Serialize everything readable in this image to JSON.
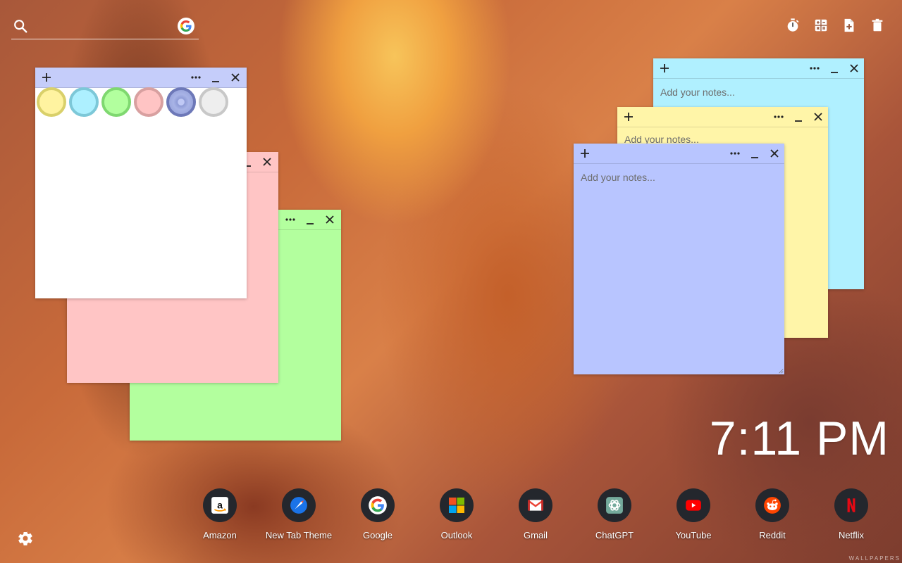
{
  "search": {
    "placeholder": ""
  },
  "toolbar": {
    "icons": [
      "timer-icon",
      "calculator-icon",
      "new-note-icon",
      "trash-icon"
    ]
  },
  "notes": {
    "white": {
      "color": "#ffffff",
      "bar_color": "#c5cdfa",
      "text": ""
    },
    "pink": {
      "color": "#ffc5c5",
      "text": ""
    },
    "green": {
      "color": "#b3ff9e",
      "text": ""
    },
    "cyan": {
      "color": "#b0f0ff",
      "text": "Add your notes..."
    },
    "yellow": {
      "color": "#fff5a8",
      "text": "Add your notes..."
    },
    "blue": {
      "color": "#b8c5ff",
      "text": "Add your notes..."
    }
  },
  "swatches": [
    {
      "name": "yellow",
      "fill": "#fff3a0",
      "ring": "#d9d06a"
    },
    {
      "name": "cyan",
      "fill": "#adf0ff",
      "ring": "#7dc8d8"
    },
    {
      "name": "green",
      "fill": "#b2ff9e",
      "ring": "#7fd870"
    },
    {
      "name": "pink",
      "fill": "#ffc4c4",
      "ring": "#d8a0a0"
    },
    {
      "name": "blue",
      "fill": "#8e9bd6",
      "ring": "#6d78b8"
    },
    {
      "name": "white",
      "fill": "#eeeeee",
      "ring": "#c8c8c8"
    }
  ],
  "clock": {
    "time": "7:11 PM"
  },
  "dock": [
    {
      "label": "Amazon"
    },
    {
      "label": "New Tab Theme"
    },
    {
      "label": "Google"
    },
    {
      "label": "Outlook"
    },
    {
      "label": "Gmail"
    },
    {
      "label": "ChatGPT"
    },
    {
      "label": "YouTube"
    },
    {
      "label": "Reddit"
    },
    {
      "label": "Netflix"
    }
  ],
  "watermark": "WALLPAPERS"
}
